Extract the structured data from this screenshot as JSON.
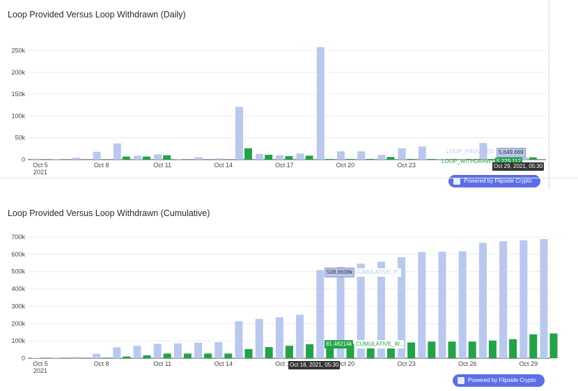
{
  "charts": {
    "top": {
      "title": "Loop Provided Versus Loop Withdrawn (Daily)"
    },
    "bottom": {
      "title": "Loop Provided Versus Loop Withdrawn (Cumulative)"
    }
  },
  "badge_text": "Powered by Flipside Crypto",
  "tooltips": {
    "top": {
      "provided_label": "LOOP_PROVIDED",
      "provided_value": "5,649.669",
      "withdrawn_label": "LOOP_WITHDRAWN",
      "withdrawn_value": "5,229.117",
      "date": "Oct 29, 2021, 05:30"
    },
    "bottom": {
      "provided_value": "508.6608k",
      "provided_label": "CUMULATIVE_P...",
      "withdrawn_value": "81.48214k",
      "withdrawn_label": "CUMULATIVE_W...",
      "date": "Oct 18, 2021, 05:30"
    }
  },
  "colors": {
    "provided": "#b9c8ee",
    "withdrawn": "#21a346",
    "badge": "#5b6fe6",
    "grid": "#ececec"
  },
  "chart_data": [
    {
      "type": "bar",
      "title": "Loop Provided Versus Loop Withdrawn (Daily)",
      "x": [
        "2021-10-05",
        "2021-10-06",
        "2021-10-07",
        "2021-10-08",
        "2021-10-09",
        "2021-10-10",
        "2021-10-11",
        "2021-10-12",
        "2021-10-13",
        "2021-10-14",
        "2021-10-15",
        "2021-10-16",
        "2021-10-17",
        "2021-10-18",
        "2021-10-19",
        "2021-10-20",
        "2021-10-21",
        "2021-10-22",
        "2021-10-23",
        "2021-10-24",
        "2021-10-25",
        "2021-10-26",
        "2021-10-27",
        "2021-10-28",
        "2021-10-29"
      ],
      "x_ticks": [
        {
          "date": "2021-10-05",
          "label": "Oct 5",
          "sublabel": "2021"
        },
        {
          "date": "2021-10-08",
          "label": "Oct 8"
        },
        {
          "date": "2021-10-11",
          "label": "Oct 11"
        },
        {
          "date": "2021-10-14",
          "label": "Oct 14"
        },
        {
          "date": "2021-10-17",
          "label": "Oct 17"
        },
        {
          "date": "2021-10-20",
          "label": "Oct 20"
        },
        {
          "date": "2021-10-23",
          "label": "Oct 23"
        }
      ],
      "series": [
        {
          "name": "LOOP_PROVIDED",
          "color": "#b9c8ee",
          "values": [
            2000,
            1500,
            4500,
            18000,
            37000,
            9000,
            12000,
            1500,
            5500,
            3000,
            121000,
            13000,
            10000,
            14000,
            258000,
            19000,
            19000,
            11000,
            26000,
            30000,
            2000,
            1500,
            38000,
            2500,
            5650
          ]
        },
        {
          "name": "LOOP_WITHDRAWN",
          "color": "#21a346",
          "values": [
            0,
            0,
            0,
            0,
            7000,
            7000,
            10000,
            0,
            0,
            0,
            26000,
            11000,
            8000,
            9000,
            1500,
            1500,
            1500,
            6000,
            1500,
            1500,
            0,
            0,
            1500,
            0,
            5229
          ]
        }
      ],
      "ylim": [
        0,
        270000
      ],
      "y_ticks": [
        "0",
        "50k",
        "100k",
        "150k",
        "200k",
        "250k"
      ],
      "y_tick_values": [
        0,
        50000,
        100000,
        150000,
        200000,
        250000
      ],
      "grid": true
    },
    {
      "type": "bar",
      "title": "Loop Provided Versus Loop Withdrawn (Cumulative)",
      "x": [
        "2021-10-05",
        "2021-10-06",
        "2021-10-07",
        "2021-10-08",
        "2021-10-09",
        "2021-10-10",
        "2021-10-11",
        "2021-10-12",
        "2021-10-13",
        "2021-10-14",
        "2021-10-15",
        "2021-10-16",
        "2021-10-17",
        "2021-10-18",
        "2021-10-19",
        "2021-10-20",
        "2021-10-21",
        "2021-10-22",
        "2021-10-23",
        "2021-10-24",
        "2021-10-25",
        "2021-10-26",
        "2021-10-27",
        "2021-10-28",
        "2021-10-29"
      ],
      "x_ticks": [
        {
          "date": "2021-10-05",
          "label": "Oct 5",
          "sublabel": "2021"
        },
        {
          "date": "2021-10-08",
          "label": "Oct 8"
        },
        {
          "date": "2021-10-11",
          "label": "Oct 11"
        },
        {
          "date": "2021-10-14",
          "label": "Oct 14"
        },
        {
          "date": "2021-10-17",
          "label": "Oct 17"
        },
        {
          "date": "2021-10-20",
          "label": "Oct 20"
        },
        {
          "date": "2021-10-23",
          "label": "Oct 23"
        },
        {
          "date": "2021-10-26",
          "label": "Oct 26"
        },
        {
          "date": "2021-10-29",
          "label": "Oct 29"
        }
      ],
      "series": [
        {
          "name": "CUMULATIVE_P...",
          "color": "#b9c8ee",
          "values": [
            2000,
            3500,
            8000,
            26000,
            63000,
            72000,
            84000,
            85000,
            90000,
            93000,
            214000,
            227000,
            237000,
            251000,
            508661,
            527000,
            546000,
            557000,
            583000,
            613000,
            615000,
            617000,
            666000,
            675000,
            681000,
            688000
          ]
        },
        {
          "name": "CUMULATIVE_W...",
          "color": "#21a346",
          "values": [
            0,
            0,
            0,
            3000,
            10000,
            17000,
            27000,
            27000,
            27000,
            27000,
            53000,
            64000,
            72000,
            81000,
            81482,
            83000,
            84000,
            90000,
            91000,
            96000,
            96000,
            96000,
            102000,
            110000,
            138000,
            143000
          ]
        }
      ],
      "ylim": [
        0,
        720000
      ],
      "y_ticks": [
        "0",
        "100k",
        "200k",
        "300k",
        "400k",
        "500k",
        "600k",
        "700k"
      ],
      "y_tick_values": [
        0,
        100000,
        200000,
        300000,
        400000,
        500000,
        600000,
        700000
      ],
      "grid": true
    }
  ]
}
